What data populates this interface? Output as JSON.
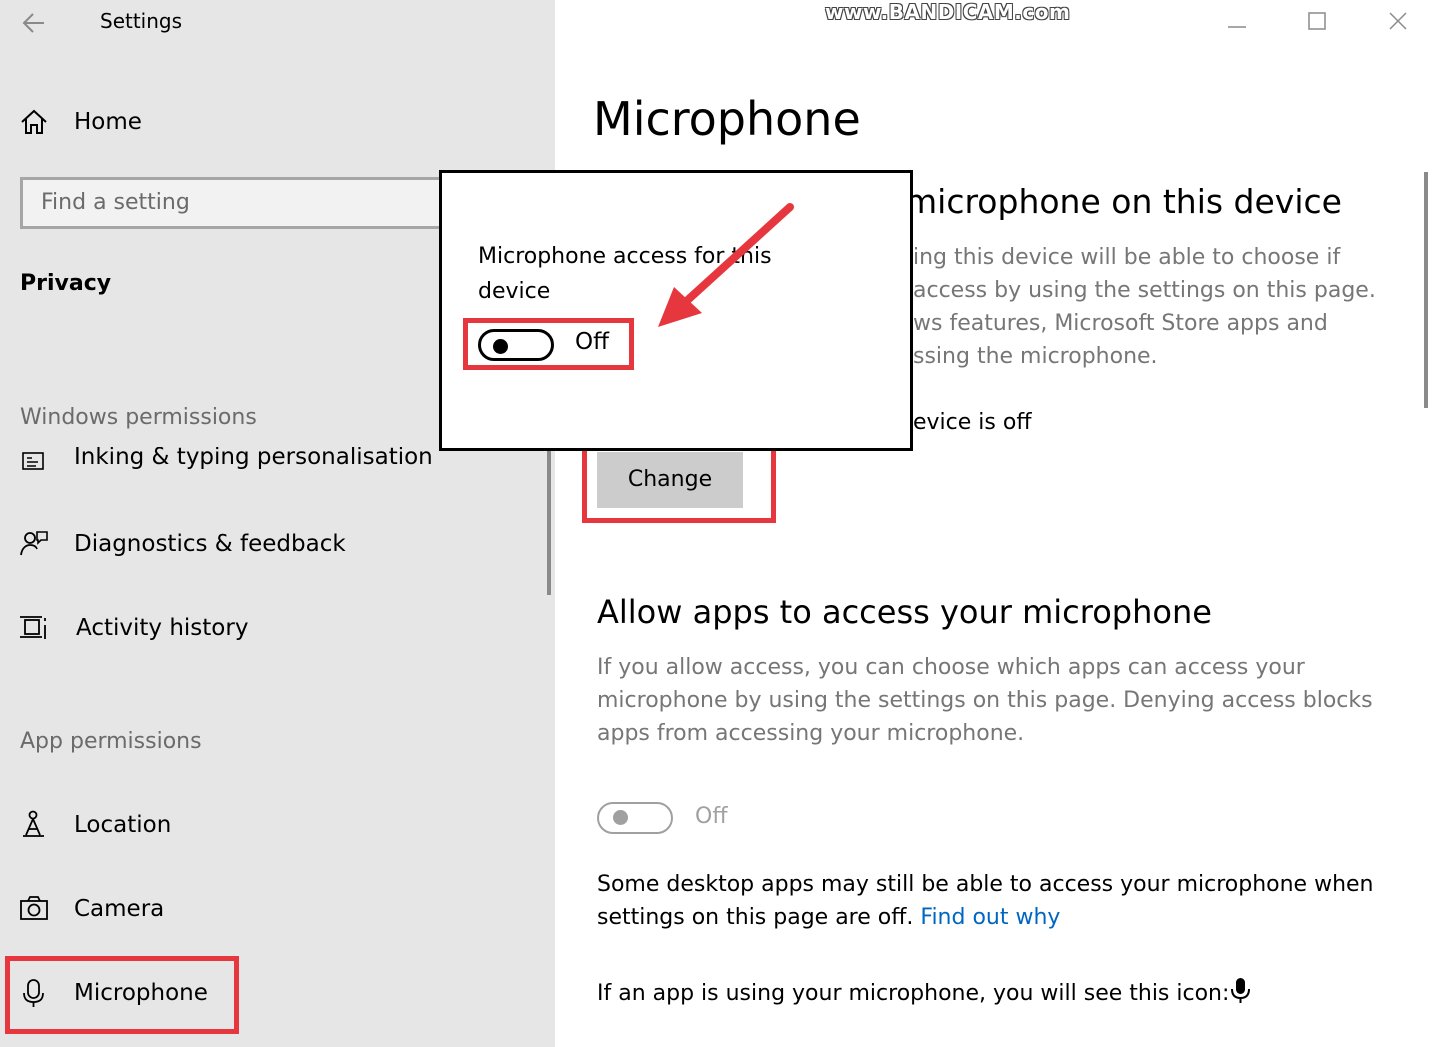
{
  "window": {
    "title": "Settings",
    "watermark": "www.BANDICAM.com"
  },
  "sidebar": {
    "home_label": "Home",
    "search_placeholder": "Find a setting",
    "category": "Privacy",
    "windows_permissions_header": "Windows permissions",
    "windows_items": [
      {
        "label": "Inking & typing personalisation",
        "icon": "inking-icon"
      },
      {
        "label": "Diagnostics & feedback",
        "icon": "diagnostics-icon"
      },
      {
        "label": "Activity history",
        "icon": "activity-history-icon"
      }
    ],
    "app_permissions_header": "App permissions",
    "app_items": [
      {
        "label": "Location",
        "icon": "location-icon"
      },
      {
        "label": "Camera",
        "icon": "camera-icon"
      },
      {
        "label": "Microphone",
        "icon": "microphone-icon",
        "selected": true
      }
    ]
  },
  "main": {
    "page_title": "Microphone",
    "device_section": {
      "heading": "microphone on this device",
      "lines": [
        "ing this device will be able to choose if",
        "access by using the settings on this page.",
        "ws features, Microsoft Store apps and",
        "ssing the microphone."
      ],
      "status": "evice is off",
      "change_button": "Change"
    },
    "apps_section": {
      "heading": "Allow apps to access your microphone",
      "description": "If you allow access, you can choose which apps can access your microphone by using the settings on this page. Denying access blocks apps from accessing your microphone.",
      "toggle_state": "Off",
      "toggle_on": false
    },
    "desktop_note": "Some desktop apps may still be able to access your microphone when settings on this page are off.",
    "find_out_link": "Find out why",
    "icon_note": "If an app is using your microphone, you will see this icon:"
  },
  "popup": {
    "label": "Microphone access for this device",
    "toggle_state": "Off",
    "toggle_on": false
  },
  "colors": {
    "annotation_red": "#e7373e",
    "sidebar_bg": "#e6e6e6",
    "link_blue": "#0067c0",
    "button_gray": "#cccccc"
  }
}
